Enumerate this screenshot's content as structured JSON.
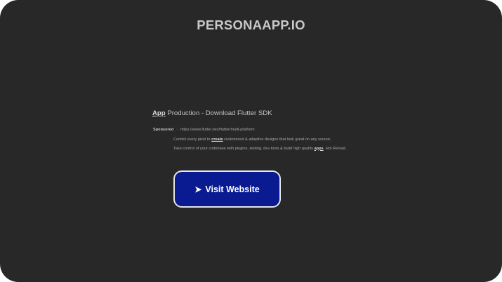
{
  "site": {
    "title": "PERSONAAPP.IO"
  },
  "ad": {
    "heading_keyword": "App",
    "heading_rest": " Production - Download Flutter SDK",
    "sponsored_label": "Sponsored",
    "separator": "·",
    "url": "https://www.flutter.dev/flutter/multi-platform",
    "body_line1_pre": "Control every pixel to ",
    "body_line1_kw": "create",
    "body_line1_post": " customized & adaptive designs that look great on any screen.",
    "body_line2_pre": "Take control of your codebase with plugins, testing, dev tools & build high quality ",
    "body_line2_kw": "apps",
    "body_line2_post": ". Hot Reload.",
    "button_icon": "➤",
    "button_label": "Visit Website"
  },
  "colors": {
    "background": "#282828",
    "button_fill": "#0a1b91",
    "button_border": "#e6e6e6",
    "title_text": "#c9c9c9"
  }
}
